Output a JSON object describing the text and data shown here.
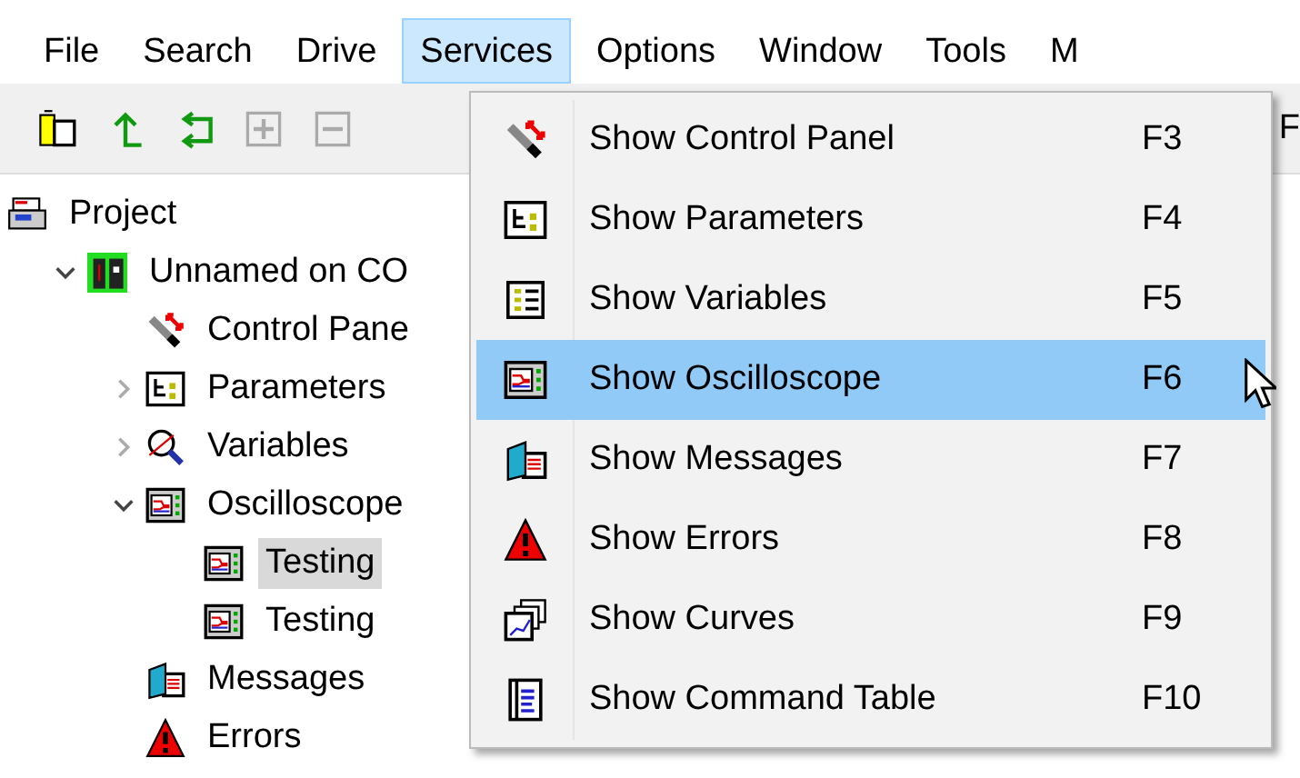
{
  "menu_bar": [
    {
      "label": "File",
      "selected": false
    },
    {
      "label": "Search",
      "selected": false
    },
    {
      "label": "Drive",
      "selected": false
    },
    {
      "label": "Services",
      "selected": true
    },
    {
      "label": "Options",
      "selected": false
    },
    {
      "label": "Window",
      "selected": false
    },
    {
      "label": "Tools",
      "selected": false
    },
    {
      "label": "M",
      "selected": false
    }
  ],
  "toolbar": {
    "buttons": [
      {
        "kind": "device"
      },
      {
        "kind": "up"
      },
      {
        "kind": "loop"
      },
      {
        "kind": "plus"
      },
      {
        "kind": "minus"
      }
    ],
    "trailing_text": "F"
  },
  "tree": [
    {
      "label": "Project",
      "kind": "project",
      "selected": false,
      "children": [
        {
          "label": "Unnamed on CO",
          "kind": "drive",
          "expanded": true,
          "selected": false,
          "children": [
            {
              "label": "Control Pane",
              "kind": "control",
              "selected": false
            },
            {
              "label": "Parameters",
              "kind": "parameters",
              "expanded": false,
              "selected": false
            },
            {
              "label": "Variables",
              "kind": "variables",
              "expanded": false,
              "selected": false
            },
            {
              "label": "Oscilloscope",
              "kind": "scope",
              "expanded": true,
              "selected": false,
              "children": [
                {
                  "label": "Testing",
                  "kind": "scope",
                  "selected": true
                },
                {
                  "label": "Testing",
                  "kind": "scope",
                  "selected": false
                }
              ]
            },
            {
              "label": "Messages",
              "kind": "messages",
              "selected": false
            },
            {
              "label": "Errors",
              "kind": "errors",
              "selected": false
            }
          ]
        }
      ]
    }
  ],
  "services_menu": [
    {
      "label": "Show Control Panel",
      "shortcut": "F3",
      "kind": "control",
      "selected": false
    },
    {
      "label": "Show Parameters",
      "shortcut": "F4",
      "kind": "parameters",
      "selected": false
    },
    {
      "label": "Show Variables",
      "shortcut": "F5",
      "kind": "list",
      "selected": false
    },
    {
      "label": "Show Oscilloscope",
      "shortcut": "F6",
      "kind": "scope",
      "selected": true
    },
    {
      "label": "Show Messages",
      "shortcut": "F7",
      "kind": "messages",
      "selected": false
    },
    {
      "label": "Show Errors",
      "shortcut": "F8",
      "kind": "errors",
      "selected": false
    },
    {
      "label": "Show Curves",
      "shortcut": "F9",
      "kind": "curves",
      "selected": false
    },
    {
      "label": "Show Command Table",
      "shortcut": "F10",
      "kind": "table",
      "selected": false
    }
  ]
}
